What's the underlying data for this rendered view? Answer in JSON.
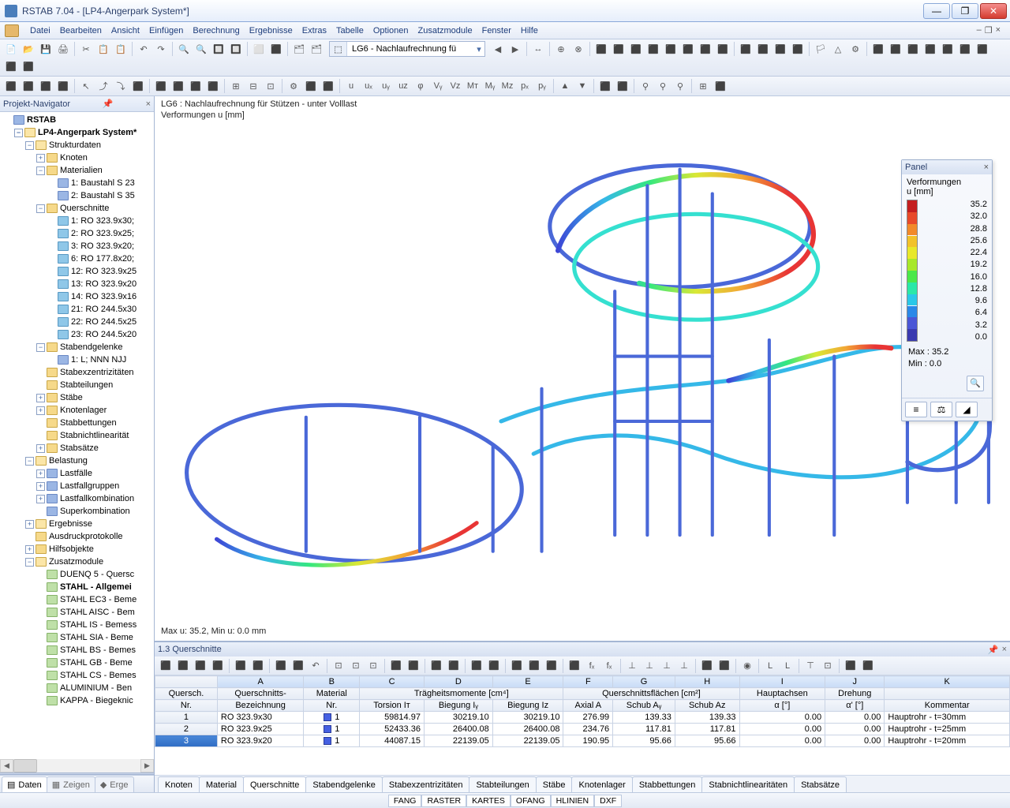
{
  "title": "RSTAB 7.04 - [LP4-Angerpark System*]",
  "menus": [
    "Datei",
    "Bearbeiten",
    "Ansicht",
    "Einfügen",
    "Berechnung",
    "Ergebnisse",
    "Extras",
    "Tabelle",
    "Optionen",
    "Zusatzmodule",
    "Fenster",
    "Hilfe"
  ],
  "mdi_buttons": [
    "–",
    "❐",
    "×"
  ],
  "lc_combo": {
    "badge": "⬚",
    "text": "LG6 - Nachlaufrechnung fü"
  },
  "nav_header": "Projekt-Navigator",
  "tree": [
    {
      "d": 0,
      "e": "",
      "ic": "node",
      "t": "RSTAB",
      "b": true
    },
    {
      "d": 1,
      "e": "-",
      "ic": "folder-o",
      "t": "LP4-Angerpark System*",
      "b": true
    },
    {
      "d": 2,
      "e": "-",
      "ic": "folder-o",
      "t": "Strukturdaten"
    },
    {
      "d": 3,
      "e": "+",
      "ic": "folder",
      "t": "Knoten"
    },
    {
      "d": 3,
      "e": "-",
      "ic": "folder",
      "t": "Materialien"
    },
    {
      "d": 4,
      "e": " ",
      "ic": "node",
      "t": "1: Baustahl S 23"
    },
    {
      "d": 4,
      "e": " ",
      "ic": "node",
      "t": "2: Baustahl S 35"
    },
    {
      "d": 3,
      "e": "-",
      "ic": "folder",
      "t": "Querschnitte"
    },
    {
      "d": 4,
      "e": " ",
      "ic": "sec",
      "t": "1: RO 323.9x30;"
    },
    {
      "d": 4,
      "e": " ",
      "ic": "sec",
      "t": "2: RO 323.9x25;"
    },
    {
      "d": 4,
      "e": " ",
      "ic": "sec",
      "t": "3: RO 323.9x20;"
    },
    {
      "d": 4,
      "e": " ",
      "ic": "sec",
      "t": "6: RO 177.8x20;"
    },
    {
      "d": 4,
      "e": " ",
      "ic": "sec",
      "t": "12: RO 323.9x25"
    },
    {
      "d": 4,
      "e": " ",
      "ic": "sec",
      "t": "13: RO 323.9x20"
    },
    {
      "d": 4,
      "e": " ",
      "ic": "sec",
      "t": "14: RO 323.9x16"
    },
    {
      "d": 4,
      "e": " ",
      "ic": "sec",
      "t": "21: RO 244.5x30"
    },
    {
      "d": 4,
      "e": " ",
      "ic": "sec",
      "t": "22: RO 244.5x25"
    },
    {
      "d": 4,
      "e": " ",
      "ic": "sec",
      "t": "23: RO 244.5x20"
    },
    {
      "d": 3,
      "e": "-",
      "ic": "folder",
      "t": "Stabendgelenke"
    },
    {
      "d": 4,
      "e": " ",
      "ic": "node",
      "t": "1: L; NNN NJJ"
    },
    {
      "d": 3,
      "e": " ",
      "ic": "folder",
      "t": "Stabexzentrizitäten"
    },
    {
      "d": 3,
      "e": " ",
      "ic": "folder",
      "t": "Stabteilungen"
    },
    {
      "d": 3,
      "e": "+",
      "ic": "folder",
      "t": "Stäbe"
    },
    {
      "d": 3,
      "e": "+",
      "ic": "folder",
      "t": "Knotenlager"
    },
    {
      "d": 3,
      "e": " ",
      "ic": "folder",
      "t": "Stabbettungen"
    },
    {
      "d": 3,
      "e": " ",
      "ic": "folder",
      "t": "Stabnichtlinearität"
    },
    {
      "d": 3,
      "e": "+",
      "ic": "folder",
      "t": "Stabsätze"
    },
    {
      "d": 2,
      "e": "-",
      "ic": "folder-o",
      "t": "Belastung"
    },
    {
      "d": 3,
      "e": "+",
      "ic": "node",
      "t": "Lastfälle"
    },
    {
      "d": 3,
      "e": "+",
      "ic": "node",
      "t": "Lastfallgruppen"
    },
    {
      "d": 3,
      "e": "+",
      "ic": "node",
      "t": "Lastfallkombination"
    },
    {
      "d": 3,
      "e": " ",
      "ic": "node",
      "t": "Superkombination"
    },
    {
      "d": 2,
      "e": "+",
      "ic": "folder-o",
      "t": "Ergebnisse"
    },
    {
      "d": 2,
      "e": " ",
      "ic": "folder",
      "t": "Ausdruckprotokolle"
    },
    {
      "d": 2,
      "e": "+",
      "ic": "folder",
      "t": "Hilfsobjekte"
    },
    {
      "d": 2,
      "e": "-",
      "ic": "folder-o",
      "t": "Zusatzmodule"
    },
    {
      "d": 3,
      "e": " ",
      "ic": "mod",
      "t": "DUENQ 5 - Quersc"
    },
    {
      "d": 3,
      "e": " ",
      "ic": "mod",
      "t": "STAHL - Allgemei",
      "b": true
    },
    {
      "d": 3,
      "e": " ",
      "ic": "mod",
      "t": "STAHL EC3 - Beme"
    },
    {
      "d": 3,
      "e": " ",
      "ic": "mod",
      "t": "STAHL AISC - Bem"
    },
    {
      "d": 3,
      "e": " ",
      "ic": "mod",
      "t": "STAHL IS - Bemess"
    },
    {
      "d": 3,
      "e": " ",
      "ic": "mod",
      "t": "STAHL SIA - Beme"
    },
    {
      "d": 3,
      "e": " ",
      "ic": "mod",
      "t": "STAHL BS - Bemes"
    },
    {
      "d": 3,
      "e": " ",
      "ic": "mod",
      "t": "STAHL GB - Beme"
    },
    {
      "d": 3,
      "e": " ",
      "ic": "mod",
      "t": "STAHL CS - Bemes"
    },
    {
      "d": 3,
      "e": " ",
      "ic": "mod",
      "t": "ALUMINIUM - Ben"
    },
    {
      "d": 3,
      "e": " ",
      "ic": "mod",
      "t": "KAPPA - Biegeknic"
    }
  ],
  "nav_tabs": [
    {
      "icon": "▤",
      "label": "Daten"
    },
    {
      "icon": "▦",
      "label": "Zeigen"
    },
    {
      "icon": "◆",
      "label": "Erge"
    }
  ],
  "vp": {
    "line1": "LG6 : Nachlaufrechnung für Stützen - unter Volllast",
    "line2": "Verformungen u [mm]",
    "footer": "Max u: 35.2, Min u: 0.0 mm"
  },
  "panel": {
    "title": "Panel",
    "caption1": "Verformungen",
    "caption2": "u [mm]",
    "ticks": [
      "35.2",
      "32.0",
      "28.8",
      "25.6",
      "22.4",
      "19.2",
      "16.0",
      "12.8",
      "9.6",
      "6.4",
      "3.2",
      "0.0"
    ],
    "stats_max": "Max  :    35.2",
    "stats_min": "Min   :      0.0"
  },
  "bp_title": "1.3 Querschnitte",
  "table": {
    "col_letters": [
      "A",
      "B",
      "C",
      "D",
      "E",
      "F",
      "G",
      "H",
      "I",
      "J",
      "K"
    ],
    "group_headers": {
      "nr": "Quersch.",
      "desc": "Querschnitts-",
      "mat": "Material",
      "inertia": "Trägheitsmomente [cm⁴]",
      "area": "Querschnittsflächen [cm²]",
      "axes": "Hauptachsen",
      "rot": "Drehung",
      "comment": ""
    },
    "sub_headers": {
      "nr": "Nr.",
      "desc": "Bezeichnung",
      "mat": "Nr.",
      "it": "Torsion Iᴛ",
      "iy": "Biegung Iᵧ",
      "iz": "Biegung Iᴢ",
      "a": "Axial A",
      "ay": "Schub Aᵧ",
      "az": "Schub Aᴢ",
      "alpha": "α [°]",
      "alpha2": "α' [°]",
      "k": "Kommentar"
    },
    "rows": [
      {
        "nr": "1",
        "desc": "RO 323.9x30",
        "mat": "1",
        "it": "59814.97",
        "iy": "30219.10",
        "iz": "30219.10",
        "a": "276.99",
        "ay": "139.33",
        "az": "139.33",
        "al": "0.00",
        "al2": "0.00",
        "k": "Hauptrohr - t=30mm"
      },
      {
        "nr": "2",
        "desc": "RO 323.9x25",
        "mat": "1",
        "it": "52433.36",
        "iy": "26400.08",
        "iz": "26400.08",
        "a": "234.76",
        "ay": "117.81",
        "az": "117.81",
        "al": "0.00",
        "al2": "0.00",
        "k": "Hauptrohr - t=25mm"
      },
      {
        "nr": "3",
        "desc": "RO 323.9x20",
        "mat": "1",
        "it": "44087.15",
        "iy": "22139.05",
        "iz": "22139.05",
        "a": "190.95",
        "ay": "95.66",
        "az": "95.66",
        "al": "0.00",
        "al2": "0.00",
        "k": "Hauptrohr - t=20mm",
        "sel": true
      }
    ]
  },
  "bp_tabs": [
    "Knoten",
    "Material",
    "Querschnitte",
    "Stabendgelenke",
    "Stabexzentrizitäten",
    "Stabteilungen",
    "Stäbe",
    "Knotenlager",
    "Stabbettungen",
    "Stabnichtlinearitäten",
    "Stabsätze"
  ],
  "bp_active_tab": "Querschnitte",
  "status": [
    "FANG",
    "RASTER",
    "KARTES",
    "OFANG",
    "HLINIEN",
    "DXF"
  ],
  "status_active": "RASTER",
  "tb_icons1": [
    "📄",
    "📂",
    "💾",
    "🖨",
    "│",
    "✂",
    "📋",
    "📋",
    "│",
    "↶",
    "↷",
    "│",
    "🔍",
    "🔍",
    "🔲",
    "🔲",
    "│",
    "⬜",
    "⬛",
    "│",
    "🗂",
    "🗂"
  ],
  "tb_icons1b": [
    "◀",
    "▶",
    "│",
    "↔",
    "│",
    "⊕",
    "⊗",
    "│",
    "⬛",
    "⬛",
    "⬛",
    "⬛",
    "⬛",
    "⬛",
    "⬛",
    "⬛",
    "│",
    "⬛",
    "⬛",
    "⬛",
    "⬛",
    "│",
    "🏳",
    "△",
    "⚙",
    "│",
    "⬛",
    "⬛",
    "⬛",
    "⬛",
    "⬛",
    "⬛",
    "⬛",
    "⬛",
    "⬛"
  ],
  "tb_icons2": [
    "⬛",
    "⬛",
    "⬛",
    "⬛",
    "│",
    "↖",
    "⤴",
    "⤵",
    "⬛",
    "│",
    "⬛",
    "⬛",
    "⬛",
    "⬛",
    "│",
    "⊞",
    "⊟",
    "⊡",
    "│",
    "⚙",
    "⬛",
    "⬛",
    "│",
    "u",
    "uₓ",
    "uᵧ",
    "uᴢ",
    "φ",
    "Vᵧ",
    "Vᴢ",
    "Mᴛ",
    "Mᵧ",
    "Mᴢ",
    "pₓ",
    "pᵧ",
    "│",
    "▲",
    "▼",
    "│",
    "⬛",
    "⬛",
    "│",
    "⚲",
    "⚲",
    "⚲",
    "│",
    "⊞",
    "⬛"
  ],
  "bp_toolbar_icons": [
    "⬛",
    "⬛",
    "⬛",
    "⬛",
    "│",
    "⬛",
    "⬛",
    "│",
    "⬛",
    "⬛",
    "↶",
    "│",
    "⊡",
    "⊡",
    "⊡",
    "│",
    "⬛",
    "⬛",
    "│",
    "⬛",
    "⬛",
    "│",
    "⬛",
    "⬛",
    "│",
    "⬛",
    "⬛",
    "⬛",
    "│",
    "⬛",
    "fₓ",
    "fₓ",
    "│",
    "⊥",
    "⊥",
    "⊥",
    "⊥",
    "│",
    "⬛",
    "⬛",
    "│",
    "◉",
    "│",
    "L",
    "L",
    "│",
    "⊤",
    "⊡",
    "│",
    "⬛",
    "⬛"
  ]
}
